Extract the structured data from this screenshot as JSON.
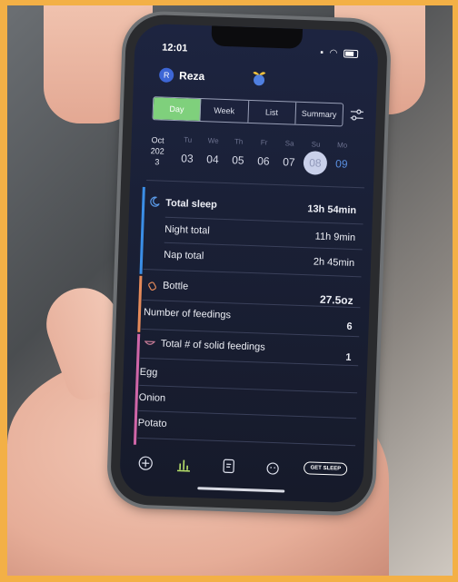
{
  "status_bar": {
    "time": "12:01"
  },
  "header": {
    "username": "Reza",
    "avatar_initial": "R"
  },
  "tabs": [
    {
      "label": "Day",
      "active": true
    },
    {
      "label": "Week",
      "active": false
    },
    {
      "label": "List",
      "active": false
    },
    {
      "label": "Summary",
      "active": false
    }
  ],
  "calendar": {
    "month": "Oct",
    "year_a": "202",
    "year_b": "3",
    "days": [
      {
        "dow": "Tu",
        "num": "03"
      },
      {
        "dow": "We",
        "num": "04"
      },
      {
        "dow": "Th",
        "num": "05"
      },
      {
        "dow": "Fr",
        "num": "06"
      },
      {
        "dow": "Sa",
        "num": "07"
      },
      {
        "dow": "Su",
        "num": "08",
        "selected": true
      },
      {
        "dow": "Mo",
        "num": "09"
      }
    ]
  },
  "sleep": {
    "total_label": "Total sleep",
    "total_value": "13h 54min",
    "night_label": "Night total",
    "night_value": "11h 9min",
    "nap_label": "Nap total",
    "nap_value": "2h 45min",
    "color": "#3b8ee6"
  },
  "feeding": {
    "bottle_label": "Bottle",
    "bottle_value": "27.5oz",
    "count_label": "Number of feedings",
    "count_value": "6",
    "color": "#e58a5a"
  },
  "solids": {
    "total_label": "Total # of solid feedings",
    "total_value": "1",
    "items": [
      "Egg",
      "Onion",
      "Potato"
    ],
    "color": "#d066a8"
  },
  "bottom_nav": {
    "get_sleep_label": "GET SLEEP"
  },
  "colors": {
    "accent_green": "#7fd07c",
    "selected_day": "#c9d0ea"
  },
  "icons": [
    "moon-icon",
    "bottle-icon",
    "bowl-icon",
    "add-icon",
    "chart-icon",
    "notes-icon",
    "baby-face-icon",
    "settings-sliders-icon"
  ]
}
